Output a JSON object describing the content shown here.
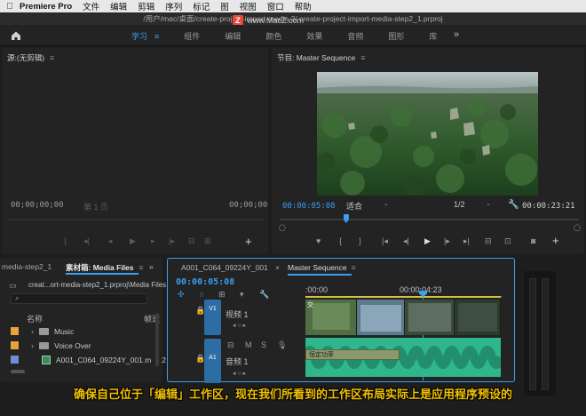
{
  "menubar": {
    "app": "Premiere Pro",
    "items": [
      "文件",
      "编辑",
      "剪辑",
      "序列",
      "标记",
      "图",
      "视图",
      "窗口",
      "帮助"
    ]
  },
  "titlebar": {
    "path": "/用户/mac/桌面/create-project-import-media 2/  create-project-import-media-step2_1.prproj"
  },
  "watermark": {
    "badge": "Z",
    "text": "www.MacZ.com"
  },
  "workspaces": {
    "tabs": [
      "学习",
      "组件",
      "编辑",
      "颜色",
      "效果",
      "音频",
      "图形",
      "库"
    ],
    "active_menu": "≡",
    "more": "»"
  },
  "source": {
    "title": "源:(无剪辑)",
    "menu": "≡",
    "tc_left": "00;00;00;00",
    "page": "第 1 页",
    "tc_right": "00;00;00"
  },
  "program": {
    "title": "节目: Master Sequence",
    "menu": "≡",
    "tc_current": "00:00:05:08",
    "fit": "适合",
    "resolution": "1/2",
    "tc_duration": "00:00:23:21",
    "playhead_fraction": 0.22
  },
  "project": {
    "tab_left": "media-step2_1",
    "tab_active": "素材箱: Media Files",
    "menu": "≡",
    "more": "»",
    "path": "creat...ort-media-step2_1.prproj\\Media Files",
    "col_name": "名称",
    "col_rate": "帧速",
    "rows": [
      {
        "name": "Music",
        "color": "#e8a33a",
        "kind": "folder",
        "count": ""
      },
      {
        "name": "Voice Over",
        "color": "#e8a33a",
        "kind": "folder",
        "count": ""
      },
      {
        "name": "A001_C064_09224Y_001.m",
        "color": "#6b8fd6",
        "kind": "clip",
        "count": "2"
      }
    ]
  },
  "timeline": {
    "tab_left": "A001_C064_09224Y_001",
    "tab_active": "Master Sequence",
    "menu": "≡",
    "tc": "00:00:05:08",
    "ruler_start": ":00:00",
    "ruler_mark": "00:00:04:23",
    "v1_label": "V1",
    "v1_name": "视频 1",
    "a1_label": "A1",
    "a1_name": "音频 1",
    "a1_buttons": [
      "M",
      "S"
    ],
    "audio_clip_label": "恒定功率",
    "video_clip_label": "交"
  },
  "subtitle": "确保自己位于「编辑」工作区，现在我们所看到的工作区布局实际上是应用程序预设的",
  "colors": {
    "accent": "#3a9ff0",
    "track_blue": "#2c6da6",
    "audio_green": "#2fb68c",
    "subtitle_yellow": "#f2c200"
  }
}
